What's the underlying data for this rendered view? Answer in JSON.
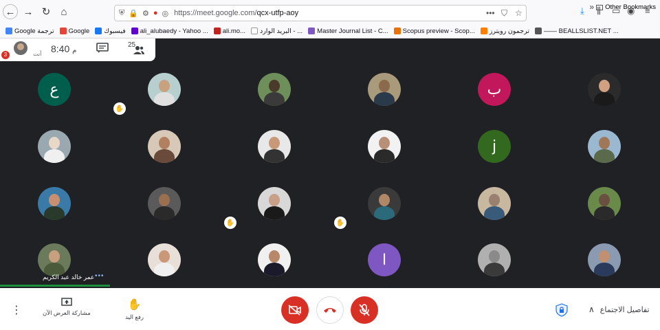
{
  "browser": {
    "url_host": "https://meet.google.com/",
    "url_path": "qcx-utfp-aoy",
    "bookmarks": [
      {
        "label": "Google ترجمة",
        "color": "#4285f4"
      },
      {
        "label": "Google",
        "color": "#ea4335"
      },
      {
        "label": "فيسبوك",
        "color": "#1877f2"
      },
      {
        "label": "ali_alubaedy - Yahoo ...",
        "color": "#6001d2"
      },
      {
        "label": "ali.mo...",
        "color": "#c5221f"
      },
      {
        "label": "البريد الوارد - ...",
        "color": "#ffffff"
      },
      {
        "label": "Master Journal List - C...",
        "color": "#7e57c2"
      },
      {
        "label": "Scopus preview - Scop...",
        "color": "#e8710a"
      },
      {
        "label": "ترجمون رويترز",
        "color": "#ff8000"
      },
      {
        "label": "—— BEALLSLIST.NET ...",
        "color": "#555555"
      }
    ],
    "other_bookmarks": "Other Bookmarks"
  },
  "meet_header": {
    "badge_count": "3",
    "self_label": "أنت",
    "time": "8:40",
    "time_suffix": "م",
    "participants_count": "25"
  },
  "participants": [
    {
      "type": "letter",
      "letter": "ع",
      "bg": "#005e4d"
    },
    {
      "type": "photo",
      "skin": "#c8a27e",
      "cloth": "#e0e0e0",
      "bg": "#b8cfd0"
    },
    {
      "type": "photo",
      "skin": "#4a3a2a",
      "cloth": "#3a3a3a",
      "bg": "#6f8f5a"
    },
    {
      "type": "photo",
      "skin": "#8a6a4a",
      "cloth": "#2a3a4a",
      "bg": "#a89a7a"
    },
    {
      "type": "letter",
      "letter": "ب",
      "bg": "#c2185b"
    },
    {
      "type": "photo",
      "skin": "#d0a080",
      "cloth": "#1a1a1a",
      "bg": "#2b2b2b"
    },
    {
      "type": "photo",
      "skin": "#e8d8c8",
      "cloth": "#f0f0f0",
      "bg": "#9aa8b0"
    },
    {
      "type": "photo",
      "skin": "#b08060",
      "cloth": "#6a4a3a",
      "bg": "#d8c8b8"
    },
    {
      "type": "photo",
      "skin": "#c89878",
      "cloth": "#333333",
      "bg": "#e8e8e8"
    },
    {
      "type": "photo",
      "skin": "#b89078",
      "cloth": "#2a2a2a",
      "bg": "#f2f2f2"
    },
    {
      "type": "letter",
      "letter": "j",
      "bg": "#33691e"
    },
    {
      "type": "photo",
      "skin": "#a07858",
      "cloth": "#5a6a4a",
      "bg": "#9ab8d0"
    },
    {
      "type": "photo",
      "skin": "#c89070",
      "cloth": "#2a3a2a",
      "bg": "#3a7aa8"
    },
    {
      "type": "photo",
      "skin": "#9a7050",
      "cloth": "#2a2a2a",
      "bg": "#5a5a5a"
    },
    {
      "type": "photo",
      "skin": "#c8a088",
      "cloth": "#1a1a1a",
      "bg": "#d8d8d8"
    },
    {
      "type": "photo",
      "skin": "#b08868",
      "cloth": "#2a6a7a",
      "bg": "#3a3a3a"
    },
    {
      "type": "photo",
      "skin": "#9a8070",
      "cloth": "#3a5a7a",
      "bg": "#c8b8a0"
    },
    {
      "type": "photo",
      "skin": "#6a5040",
      "cloth": "#2a2a2a",
      "bg": "#6a8a4a"
    },
    {
      "type": "photo",
      "skin": "#c8a080",
      "cloth": "#4a5a3a",
      "bg": "#6a7a5a"
    },
    {
      "type": "photo",
      "skin": "#c89878",
      "cloth": "#f0f0f0",
      "bg": "#e8e0d8"
    },
    {
      "type": "photo",
      "skin": "#b88868",
      "cloth": "#1a1a2a",
      "bg": "#f0f0f0"
    },
    {
      "type": "letter",
      "letter": "ا",
      "bg": "#7e57c2"
    },
    {
      "type": "photo",
      "skin": "#8a8a8a",
      "cloth": "#3a3a3a",
      "bg": "#b0b0b0"
    },
    {
      "type": "photo",
      "skin": "#c09070",
      "cloth": "#2a3a5a",
      "bg": "#8a9ab0"
    }
  ],
  "speaker_name": "عمر خالد عبد الكريم",
  "bottom_bar": {
    "present_label": "مشاركة العرض الآن",
    "raise_hand_label": "رفع اليد",
    "details_label": "تفاصيل الاجتماع"
  },
  "colors": {
    "end_call_red": "#d93025",
    "meet_bg": "#202124"
  }
}
